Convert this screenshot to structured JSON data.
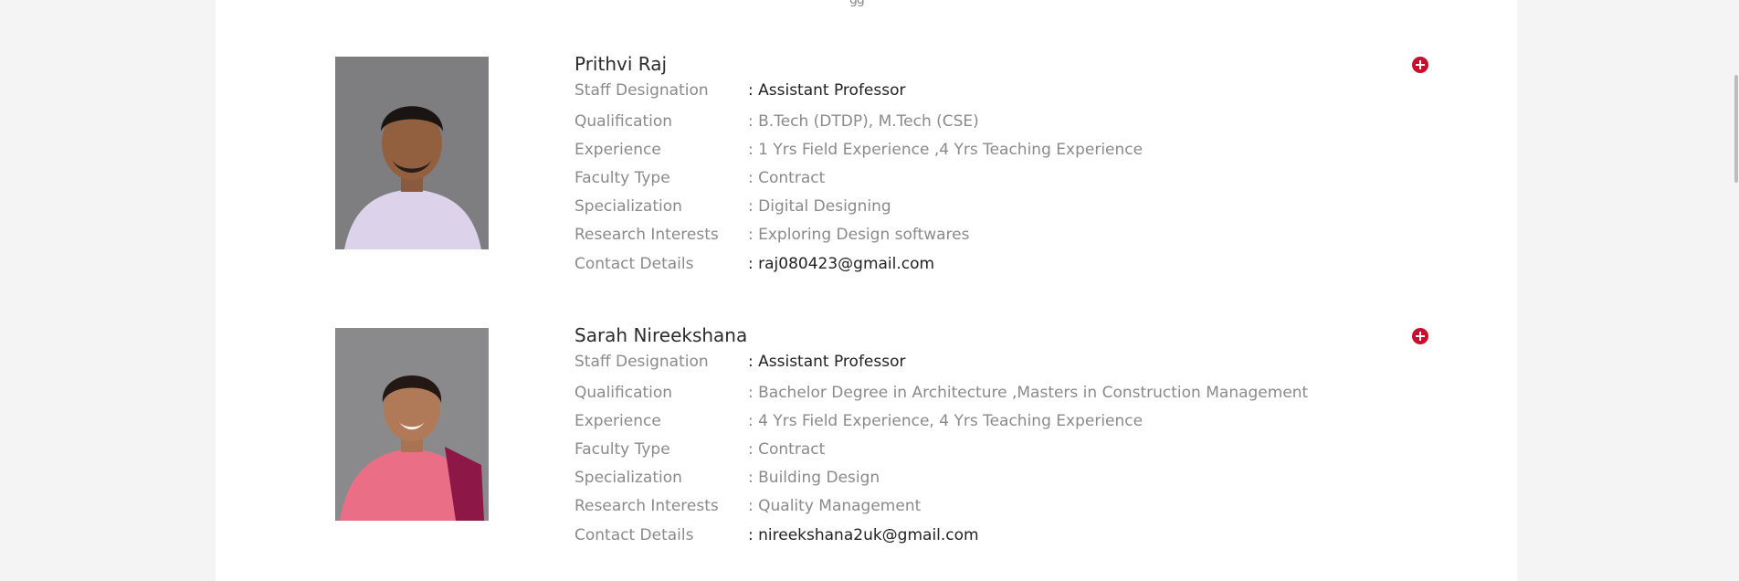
{
  "faculty": [
    {
      "name": "Prithvi Raj",
      "designation": ": Assistant Professor",
      "qualification": ": B.Tech (DTDP), M.Tech (CSE)",
      "experience": ": 1 Yrs Field Experience ,4 Yrs Teaching Experience",
      "faculty_type": ": Contract",
      "specialization": ": Digital Designing",
      "research_interests": ": Exploring Design softwares",
      "contact": ": raj080423@gmail.com"
    },
    {
      "name": "Sarah Nireekshana",
      "designation": ": Assistant Professor",
      "qualification": ": Bachelor Degree in Architecture ,Masters in Construction Management",
      "experience": ": 4 Yrs Field Experience, 4 Yrs Teaching Experience",
      "faculty_type": ": Contract",
      "specialization": ": Building Design",
      "research_interests": ": Quality Management",
      "contact": ": nireekshana2uk@gmail.com"
    }
  ],
  "labels": {
    "designation": "Staff Designation",
    "qualification": "Qualification",
    "experience": "Experience",
    "faculty_type": "Faculty Type",
    "specialization": "Specialization",
    "research_interests": "Research Interests",
    "contact": "Contact Details"
  },
  "icons": {
    "expand": "plus-circle-icon"
  },
  "colors": {
    "accent": "#c8102e",
    "label": "#8a8a8a",
    "name": "#2b2b2b"
  }
}
